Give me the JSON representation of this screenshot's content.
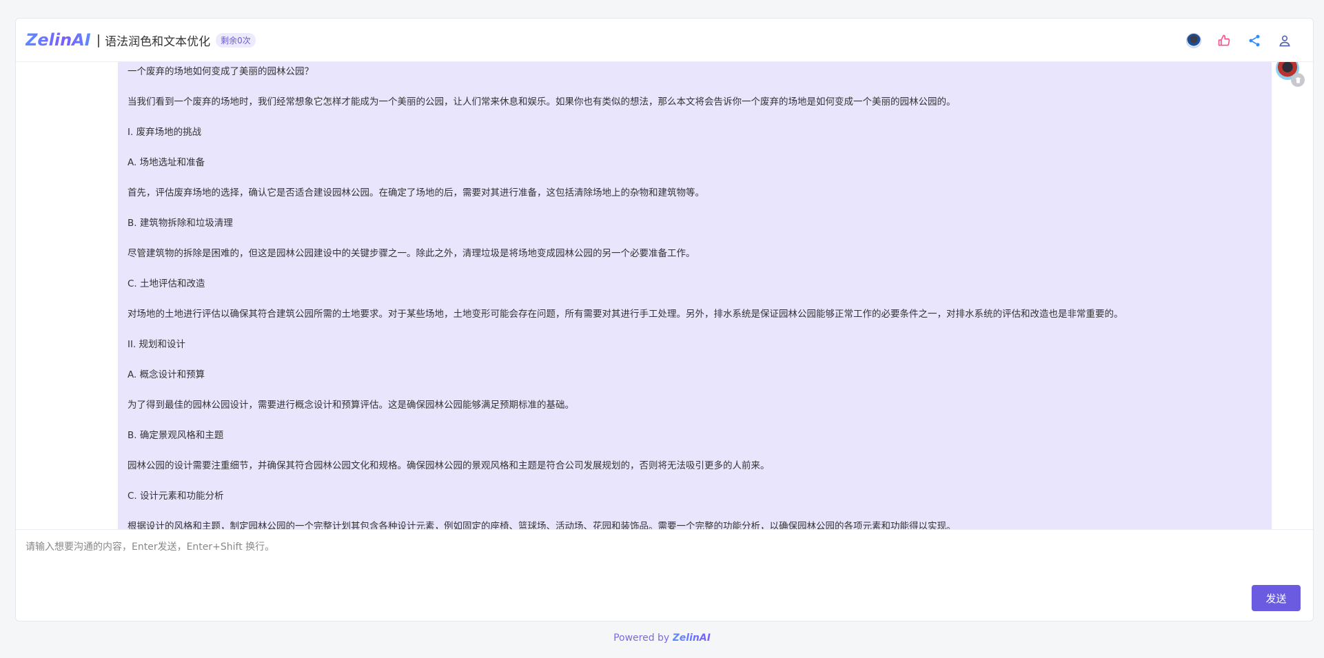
{
  "header": {
    "logo": "ZelinAI",
    "separator": "|",
    "title": "语法润色和文本优化",
    "badge": "剩余0次"
  },
  "header_actions": [
    {
      "icon": "user-avatar"
    },
    {
      "icon": "thumbs-up-icon"
    },
    {
      "icon": "share-icon"
    },
    {
      "icon": "user-profile-icon"
    }
  ],
  "message": {
    "paragraphs": [
      "一个废弃的场地如何变成了美丽的园林公园？",
      "当我们看到一个废弃的场地时，我们经常想象它怎样才能成为一个美丽的公园，让人们常来休息和娱乐。如果你也有类似的想法，那么本文将会告诉你一个废弃的场地是如何变成一个美丽的园林公园的。",
      "I. 废弃场地的挑战",
      "A. 场地选址和准备",
      "首先，评估废弃场地的选择，确认它是否适合建设园林公园。在确定了场地的后，需要对其进行准备，这包括清除场地上的杂物和建筑物等。",
      "B. 建筑物拆除和垃圾清理",
      "尽管建筑物的拆除是困难的，但这是园林公园建设中的关键步骤之一。除此之外，清理垃圾是将场地变成园林公园的另一个必要准备工作。",
      "C. 土地评估和改造",
      "对场地的土地进行评估以确保其符合建筑公园所需的土地要求。对于某些场地，土地变形可能会存在问题，所有需要对其进行手工处理。另外，排水系统是保证园林公园能够正常工作的必要条件之一，对排水系统的评估和改造也是非常重要的。",
      "II. 规划和设计",
      "A. 概念设计和预算",
      "为了得到最佳的园林公园设计，需要进行概念设计和预算评估。这是确保园林公园能够满足预期标准的基础。",
      "B. 确定景观风格和主题",
      "园林公园的设计需要注重细节，并确保其符合园林公园文化和规格。确保园林公园的景观风格和主题是符合公司发展规划的，否则将无法吸引更多的人前来。",
      "C. 设计元素和功能分析",
      "根据设计的风格和主题，制定园林公园的一个完整计划其包含各种设计元素，例如固定的座椅、篮球场、活动场、花园和装饰品。需要一个完整的功能分析，以确保园林公园的各项元素和功能得以实现。"
    ]
  },
  "composer": {
    "placeholder": "请输入想要沟通的内容，Enter发送，Enter+Shift 换行。",
    "send_label": "发送"
  },
  "footer": {
    "prefix": "Powered by ",
    "brand": "ZelinAI"
  }
}
